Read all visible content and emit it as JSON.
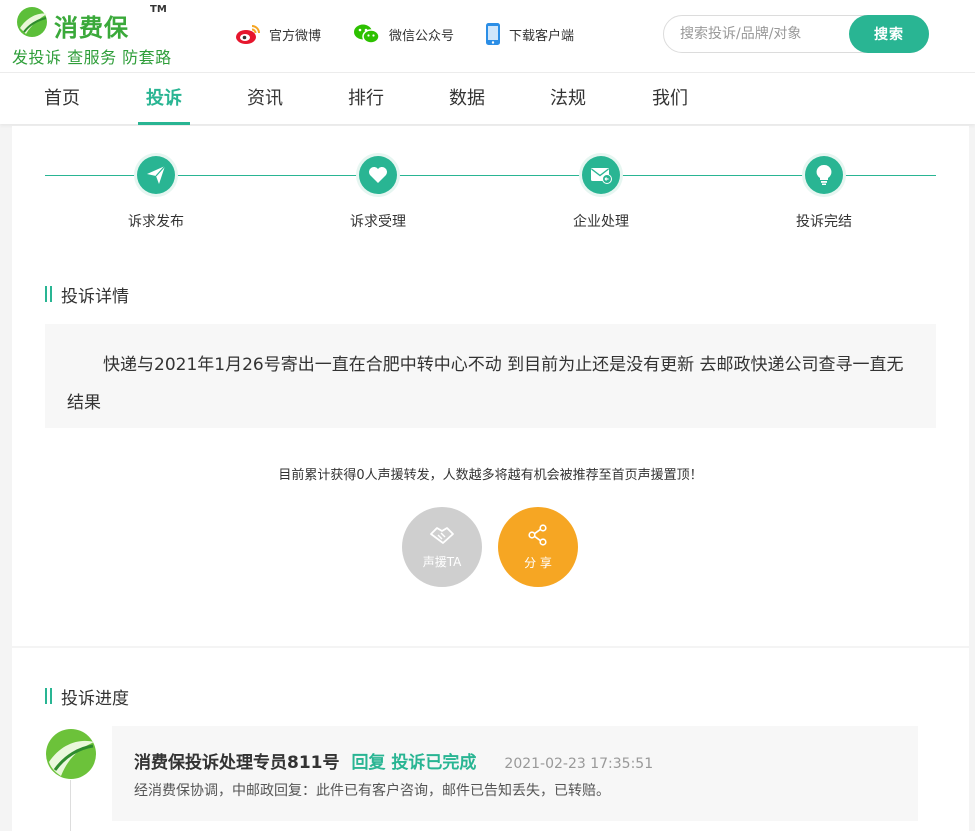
{
  "brand": {
    "name": "消费保",
    "tm": "TM",
    "slogan": "发投诉 查服务 防套路"
  },
  "header_links": [
    {
      "label": "官方微博",
      "icon": "weibo-icon"
    },
    {
      "label": "微信公众号",
      "icon": "wechat-icon"
    },
    {
      "label": "下载客户端",
      "icon": "phone-icon"
    }
  ],
  "search": {
    "placeholder": "搜索投诉/品牌/对象",
    "button_label": "搜索"
  },
  "nav": [
    {
      "label": "首页"
    },
    {
      "label": "投诉",
      "active": true
    },
    {
      "label": "资讯"
    },
    {
      "label": "排行"
    },
    {
      "label": "数据"
    },
    {
      "label": "法规"
    },
    {
      "label": "我们"
    }
  ],
  "steps": [
    {
      "label": "诉求发布",
      "icon": "paper-plane-icon"
    },
    {
      "label": "诉求受理",
      "icon": "heart-icon"
    },
    {
      "label": "企业处理",
      "icon": "mail-reply-icon"
    },
    {
      "label": "投诉完结",
      "icon": "lightbulb-icon"
    }
  ],
  "detail": {
    "title": "投诉详情",
    "text": "快递与2021年1月26号寄出一直在合肥中转中心不动 到目前为止还是没有更新 去邮政快递公司查寻一直无结果"
  },
  "support": {
    "text": "目前累计获得0人声援转发，人数越多将越有机会被推荐至首页声援置顶！",
    "support_button": "声援TA",
    "share_button": "分 享"
  },
  "progress": {
    "title": "投诉进度",
    "reply": {
      "author": "消费保投诉处理专员811号",
      "status": "回复 投诉已完成",
      "time": "2021-02-23 17:35:51",
      "body": "经消费保协调，中邮政回复：此件已有客户咨询，邮件已告知丢失，已转赔。"
    }
  },
  "colors": {
    "accent": "#29b593",
    "brand_green": "#3aa93a",
    "share": "#f6a623",
    "support_disabled": "#cfcfcf"
  }
}
